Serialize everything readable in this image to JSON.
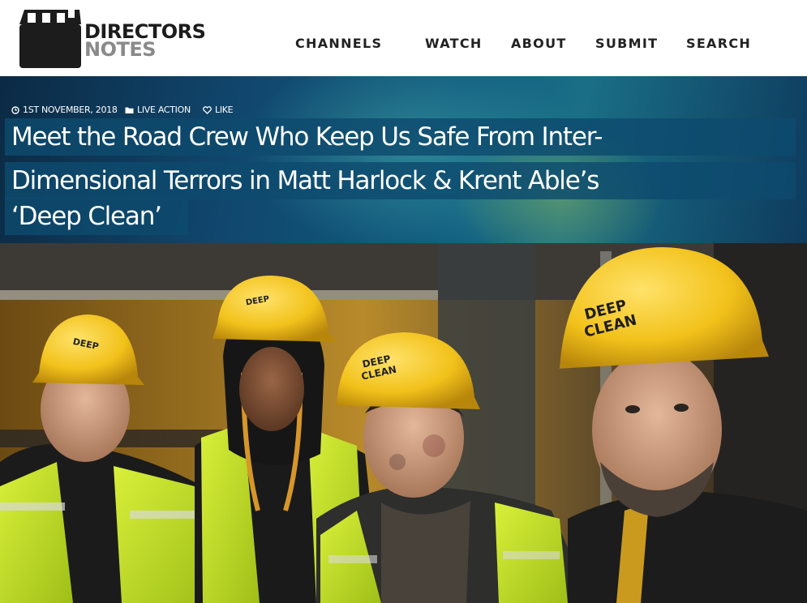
{
  "site": {
    "logo_line1": "DIRECTORS",
    "logo_line2": "NOTES"
  },
  "nav": {
    "items": [
      {
        "label": "CHANNELS"
      },
      {
        "label": "WATCH"
      },
      {
        "label": "ABOUT"
      },
      {
        "label": "SUBMIT"
      },
      {
        "label": "SEARCH"
      }
    ]
  },
  "article": {
    "date": "1ST NOVEMBER, 2018",
    "category": "LIVE ACTION",
    "like_label": "LIKE",
    "title_lines": [
      "Meet the Road Crew Who Keep Us Safe From Inter-",
      "Dimensional Terrors in Matt Harlock & Krent Able’s",
      "‘Deep  Clean’"
    ],
    "image": {
      "helmet_text_line1": "DEEP",
      "helmet_text_line2": "CLEAN"
    }
  },
  "colors": {
    "banner_blue": "#0e4a6e",
    "helmet_yellow": "#f2c21b",
    "vest_green": "#c9e62a"
  }
}
